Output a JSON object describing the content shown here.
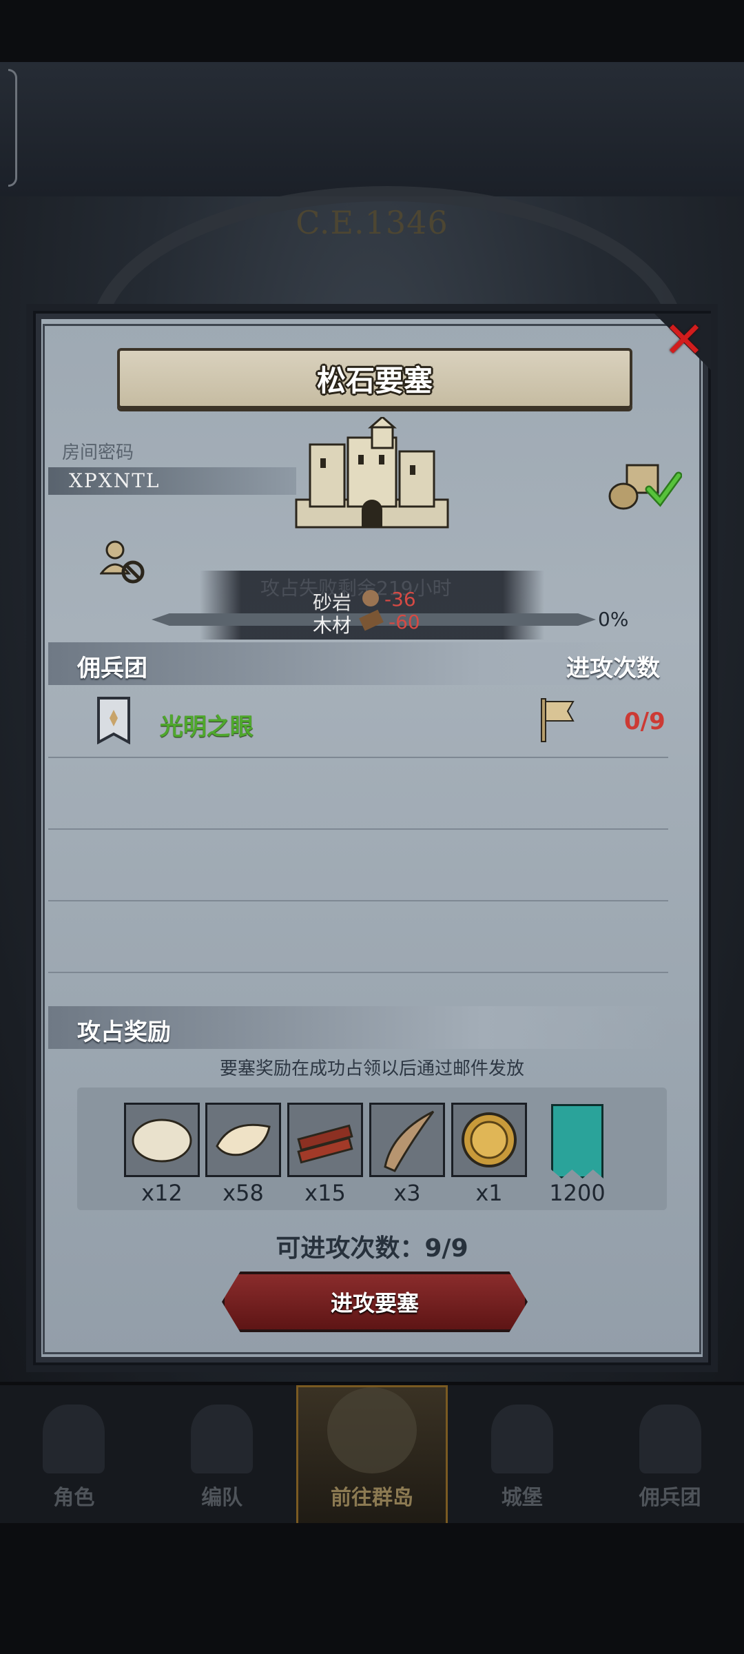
{
  "background": {
    "year": "C.E.1346",
    "nav": [
      {
        "label": "角色",
        "active": false
      },
      {
        "label": "编队",
        "active": false
      },
      {
        "label": "前往群岛",
        "active": true
      },
      {
        "label": "城堡",
        "active": false
      },
      {
        "label": "佣兵团",
        "active": false
      }
    ]
  },
  "dialog": {
    "title": "松石要塞",
    "room_code_label": "房间密码",
    "room_code": "XPXNTL",
    "occupation_text": "攻占失败剩余219小时",
    "costs": [
      {
        "name": "砂岩",
        "icon": "stone-icon",
        "value": "-36"
      },
      {
        "name": "木材",
        "icon": "wood-icon",
        "value": "-60"
      }
    ],
    "progress_pct": "0%",
    "progress_value": 0,
    "mercenary_header": "佣兵团",
    "attacks_header": "进攻次数",
    "guilds": [
      {
        "name": "光明之眼",
        "count": "0/9"
      }
    ],
    "reward_header": "攻占奖励",
    "reward_note": "要塞奖励在成功占领以后通过邮件发放",
    "rewards": [
      {
        "icon": "fur-icon",
        "qty": "x12"
      },
      {
        "icon": "wool-icon",
        "qty": "x58"
      },
      {
        "icon": "wood-planks-icon",
        "qty": "x15"
      },
      {
        "icon": "horn-icon",
        "qty": "x3"
      },
      {
        "icon": "knight-medal-icon",
        "qty": "x1"
      },
      {
        "icon": "banner-icon",
        "qty": "1200"
      }
    ],
    "attack_count_text": "可进攻次数：9/9",
    "attack_button": "进攻要塞"
  },
  "colors": {
    "accent_green": "#4fa82d",
    "accent_red": "#cc3a34",
    "button_red": "#7a2222"
  }
}
